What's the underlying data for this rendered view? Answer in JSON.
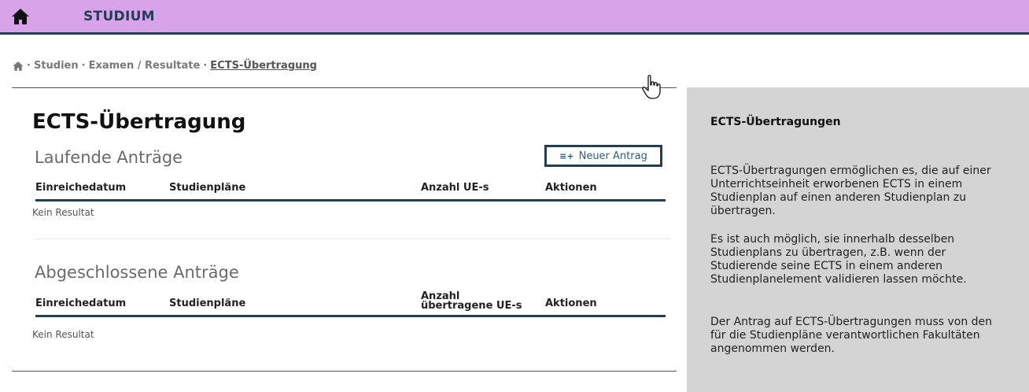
{
  "app": {
    "title": "STUDIUM"
  },
  "breadcrumb": {
    "sep": "·",
    "items": [
      "Studien",
      "Examen / Resultate",
      "ECTS-Übertragung"
    ]
  },
  "page": {
    "title": "ECTS-Übertragung"
  },
  "running": {
    "title": "Laufende Anträge",
    "new_button": "Neuer Antrag",
    "columns": [
      "Einreichedatum",
      "Studienpläne",
      "Anzahl UE-s",
      "Aktionen"
    ],
    "empty": "Kein Resultat"
  },
  "finished": {
    "title": "Abgeschlossene Anträge",
    "columns": [
      "Einreichedatum",
      "Studienpläne",
      "Anzahl übertragene UE-s",
      "Aktionen"
    ],
    "empty": "Kein Resultat"
  },
  "sidebar": {
    "title": "ECTS-Übertragungen",
    "paragraphs": [
      "ECTS-Übertragungen ermöglichen es, die auf einer Unterrichtseinheit erworbenen ECTS in einem Studienplan auf einen anderen Studienplan zu übertragen.",
      "Es ist auch möglich, sie innerhalb desselben Studienplans zu übertragen, z.B. wenn der Studierende seine ECTS in einem anderen Studienplanelement validieren lassen möchte.",
      "Der Antrag auf ECTS-Übertragungen muss von den für die Studienpläne verantwortlichen Fakultäten angenommen werden."
    ]
  },
  "colors": {
    "topbar": "#d9a3e9",
    "navy": "#243e50",
    "sidebar": "#d4d4d4"
  },
  "icons": {
    "home": "home-icon",
    "new": "add-list-icon",
    "cursor": "hand-pointer-icon"
  }
}
